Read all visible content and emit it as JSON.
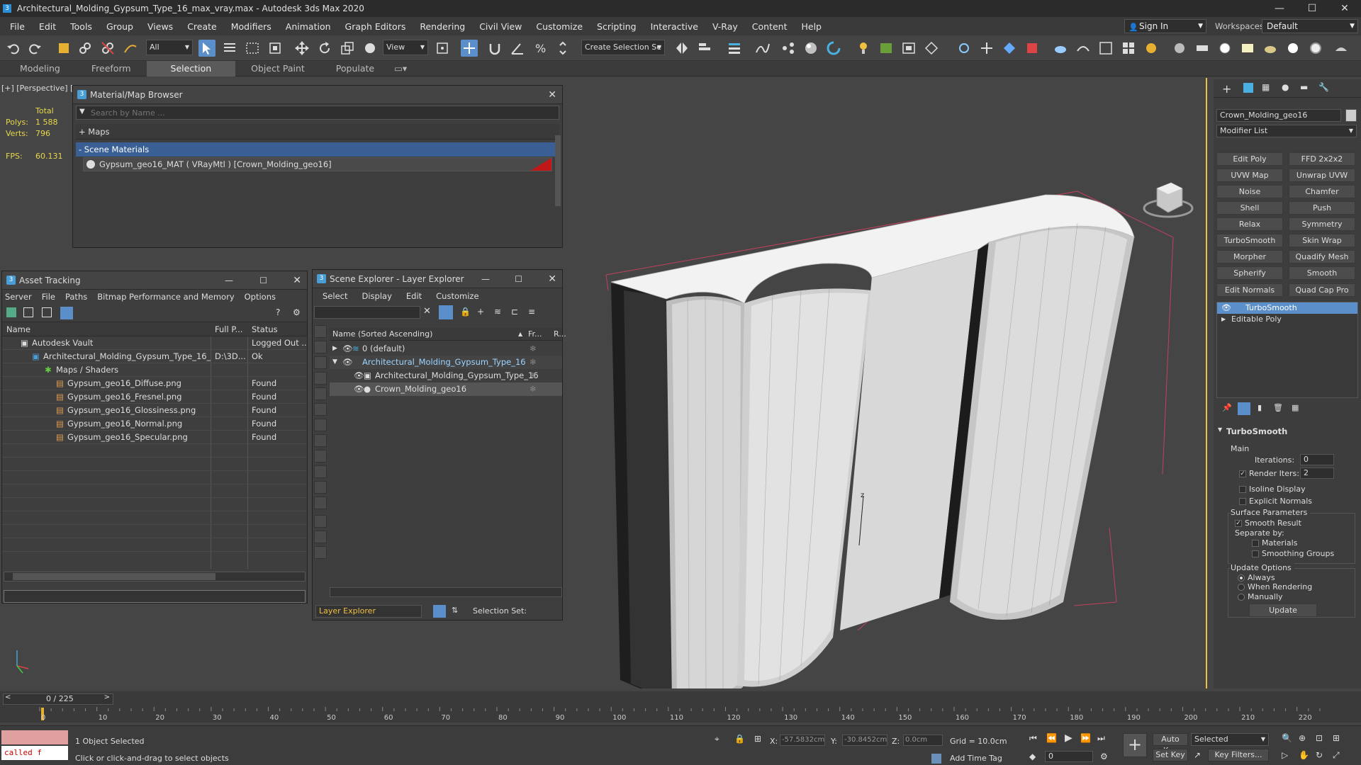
{
  "window": {
    "title": "Architectural_Molding_Gypsum_Type_16_max_vray.max - Autodesk 3ds Max 2020"
  },
  "menu": [
    "File",
    "Edit",
    "Tools",
    "Group",
    "Views",
    "Create",
    "Modifiers",
    "Animation",
    "Graph Editors",
    "Rendering",
    "Civil View",
    "Customize",
    "Scripting",
    "Interactive",
    "V-Ray",
    "Content",
    "Help"
  ],
  "account": {
    "sign_in": "Sign In",
    "workspaces_label": "Workspaces:",
    "workspace": "Default"
  },
  "toolbar": {
    "filter": "All",
    "ref_coord": "View",
    "selection_set": "Create Selection Se"
  },
  "ribbon": {
    "tabs": [
      "Modeling",
      "Freeform",
      "Selection",
      "Object Paint",
      "Populate"
    ]
  },
  "viewport": {
    "label": "[+] [Perspective] [",
    "stats": {
      "total": "Total",
      "polys_label": "Polys:",
      "polys": "1 588",
      "verts_label": "Verts:",
      "verts": "796",
      "fps_label": "FPS:",
      "fps": "60.131"
    }
  },
  "material_browser": {
    "title": "Material/Map Browser",
    "search_placeholder": "Search by Name ...",
    "maps": "+ Maps",
    "scene_materials": "- Scene Materials",
    "item": "Gypsum_geo16_MAT ( VRayMtl ) [Crown_Molding_geo16]"
  },
  "asset_tracking": {
    "title": "Asset Tracking",
    "menu": [
      "Server",
      "File",
      "Paths",
      "Bitmap Performance and Memory",
      "Options"
    ],
    "columns": [
      "Name",
      "Full P...",
      "Status"
    ],
    "rows": [
      {
        "name": "Autodesk Vault",
        "path": "",
        "status": "Logged Out ..."
      },
      {
        "name": "Architectural_Molding_Gypsum_Type_16_...",
        "path": "D:\\3D...",
        "status": "Ok"
      },
      {
        "name": "Maps / Shaders",
        "path": "",
        "status": ""
      },
      {
        "name": "Gypsum_geo16_Diffuse.png",
        "path": "",
        "status": "Found"
      },
      {
        "name": "Gypsum_geo16_Fresnel.png",
        "path": "",
        "status": "Found"
      },
      {
        "name": "Gypsum_geo16_Glossiness.png",
        "path": "",
        "status": "Found"
      },
      {
        "name": "Gypsum_geo16_Normal.png",
        "path": "",
        "status": "Found"
      },
      {
        "name": "Gypsum_geo16_Specular.png",
        "path": "",
        "status": "Found"
      }
    ]
  },
  "scene_explorer": {
    "title": "Scene Explorer - Layer Explorer",
    "menu": [
      "Select",
      "Display",
      "Edit",
      "Customize"
    ],
    "columns": [
      "Name (Sorted Ascending)",
      "Fr...",
      "R..."
    ],
    "rows": [
      {
        "name": "0 (default)"
      },
      {
        "name": "Architectural_Molding_Gypsum_Type_16"
      },
      {
        "name": "Architectural_Molding_Gypsum_Type_16"
      },
      {
        "name": "Crown_Molding_geo16"
      }
    ],
    "footer_mode": "Layer Explorer",
    "selection_set": "Selection Set:"
  },
  "command_panel": {
    "object_name": "Crown_Molding_geo16",
    "modifier_list": "Modifier List",
    "buttons": [
      "Edit Poly",
      "FFD 2x2x2",
      "UVW Map",
      "Unwrap UVW",
      "Noise",
      "Chamfer",
      "Shell",
      "Push",
      "Relax",
      "Symmetry",
      "TurboSmooth",
      "Skin Wrap",
      "Morpher",
      "Quadify Mesh",
      "Spherify",
      "Smooth",
      "Edit Normals",
      "Quad Cap Pro"
    ],
    "stack": [
      "TurboSmooth",
      "Editable Poly"
    ],
    "turbosmooth": {
      "title": "TurboSmooth",
      "main": "Main",
      "iterations_label": "Iterations:",
      "iterations": "0",
      "render_iters_label": "Render Iters:",
      "render_iters": "2",
      "isoline": "Isoline Display",
      "explicit": "Explicit Normals",
      "surface_params": "Surface Parameters",
      "smooth_result": "Smooth Result",
      "separate_by": "Separate by:",
      "materials": "Materials",
      "smoothing_groups": "Smoothing Groups",
      "update_options": "Update Options",
      "always": "Always",
      "when_rendering": "When Rendering",
      "manually": "Manually",
      "update": "Update"
    }
  },
  "timeline": {
    "frame": "0 / 225",
    "ticks": [
      "0",
      "10",
      "20",
      "30",
      "40",
      "50",
      "60",
      "70",
      "80",
      "90",
      "100",
      "110",
      "120",
      "130",
      "140",
      "150",
      "160",
      "170",
      "180",
      "190",
      "200",
      "210",
      "220"
    ]
  },
  "status": {
    "script": "called f",
    "objects": "1 Object Selected",
    "prompt": "Click or click-and-drag to select objects",
    "x_label": "X:",
    "x": "-57.5832cm",
    "y_label": "Y:",
    "y": "-30.8452cm",
    "z_label": "Z:",
    "z": "0.0cm",
    "grid": "Grid = 10.0cm",
    "add_time_tag": "Add Time Tag",
    "auto_key": "Auto Key",
    "selected": "Selected",
    "set_key": "Set Key",
    "key_filters": "Key Filters...",
    "frame_spin": "0"
  }
}
